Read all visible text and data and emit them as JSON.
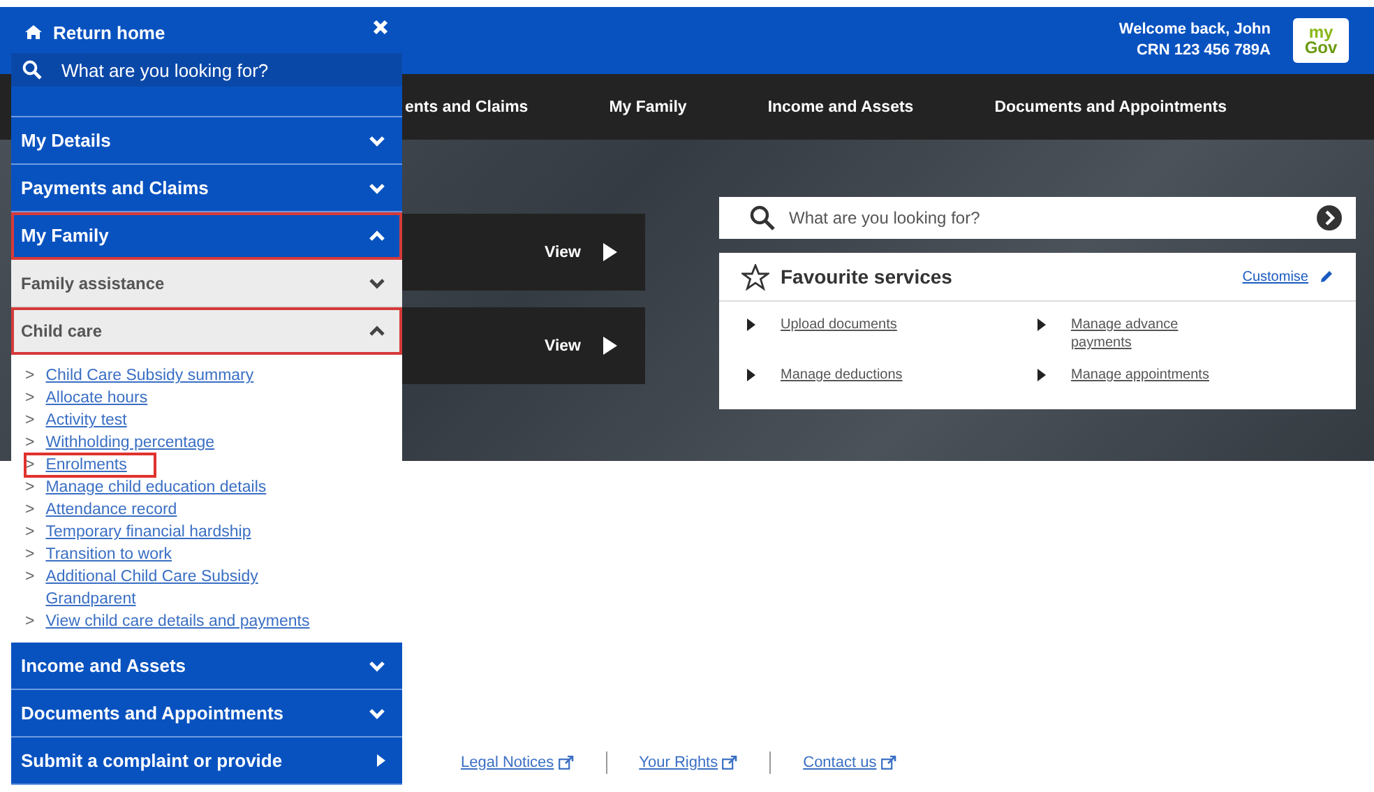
{
  "header": {
    "welcome": "Welcome back, John",
    "crn": "CRN 123 456 789A",
    "logo": {
      "line_1": "my",
      "line_2": "Gov"
    }
  },
  "nav": [
    "ents and Claims",
    "My Family",
    "Income and Assets",
    "Documents and Appointments"
  ],
  "tiles": [
    {
      "action": "View"
    },
    {
      "action": "View"
    }
  ],
  "search": {
    "placeholder": "What are you looking for?"
  },
  "favourites": {
    "title": "Favourite services",
    "customise": "Customise",
    "items": [
      "Upload documents",
      "Manage advance payments",
      "Manage deductions",
      "Manage appointments"
    ]
  },
  "footer": [
    "Legal Notices",
    "Your Rights",
    "Contact us"
  ],
  "sidebar": {
    "return_home": "Return home",
    "search": {
      "placeholder": "What are you looking for?"
    },
    "items": [
      {
        "label": "My Details",
        "kind": "menu",
        "expanded": false,
        "highlighted": false
      },
      {
        "label": "Payments and Claims",
        "kind": "menu",
        "expanded": false,
        "highlighted": false
      },
      {
        "label": "My Family",
        "kind": "menu",
        "expanded": true,
        "highlighted": true,
        "children": [
          {
            "label": "Family assistance",
            "expanded": false,
            "highlighted": false
          },
          {
            "label": "Child care",
            "expanded": true,
            "highlighted": true,
            "children": [
              {
                "marker": ">",
                "label": "Child Care Subsidy summary",
                "highlighted": false
              },
              {
                "marker": ">",
                "label": "Allocate hours",
                "highlighted": false
              },
              {
                "marker": ">",
                "label": "Activity test",
                "highlighted": false
              },
              {
                "marker": ">",
                "label": "Withholding percentage",
                "highlighted": false
              },
              {
                "marker": ">",
                "label": "Enrolments",
                "highlighted": true
              },
              {
                "marker": ">",
                "label": "Manage child education details",
                "highlighted": false
              },
              {
                "marker": ">",
                "label": "Attendance record",
                "highlighted": false
              },
              {
                "marker": ">",
                "label": "Temporary financial hardship",
                "highlighted": false
              },
              {
                "marker": ">",
                "label": "Transition to work",
                "highlighted": false
              },
              {
                "marker": ">",
                "label": "Additional Child Care Subsidy Grandparent",
                "highlighted": false
              },
              {
                "marker": ">",
                "label": "View child care details and payments",
                "highlighted": false
              }
            ]
          }
        ]
      },
      {
        "label": "Income and Assets",
        "kind": "menu",
        "expanded": false,
        "highlighted": false
      },
      {
        "label": "Documents and Appointments",
        "kind": "menu",
        "expanded": false,
        "highlighted": false
      },
      {
        "label": "Submit a complaint or provide",
        "kind": "page",
        "expanded": false,
        "highlighted": false
      }
    ]
  }
}
